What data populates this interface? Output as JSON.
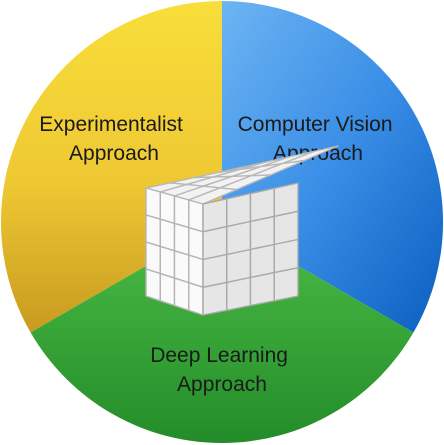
{
  "segments": [
    {
      "id": "experimentalist",
      "lines": [
        "Experimentalist",
        "Approach"
      ],
      "color_light": "#f7dc3c",
      "color_dark": "#c69a1d"
    },
    {
      "id": "computer-vision",
      "lines": [
        "Computer Vision",
        "Approach"
      ],
      "color_light": "#5aaaf1",
      "color_dark": "#0b63c1"
    },
    {
      "id": "deep-learning",
      "lines": [
        "Deep Learning",
        "Approach"
      ],
      "color_light": "#46b843",
      "color_dark": "#1f8a26"
    }
  ],
  "center": {
    "icon": "cube-grid-icon"
  }
}
